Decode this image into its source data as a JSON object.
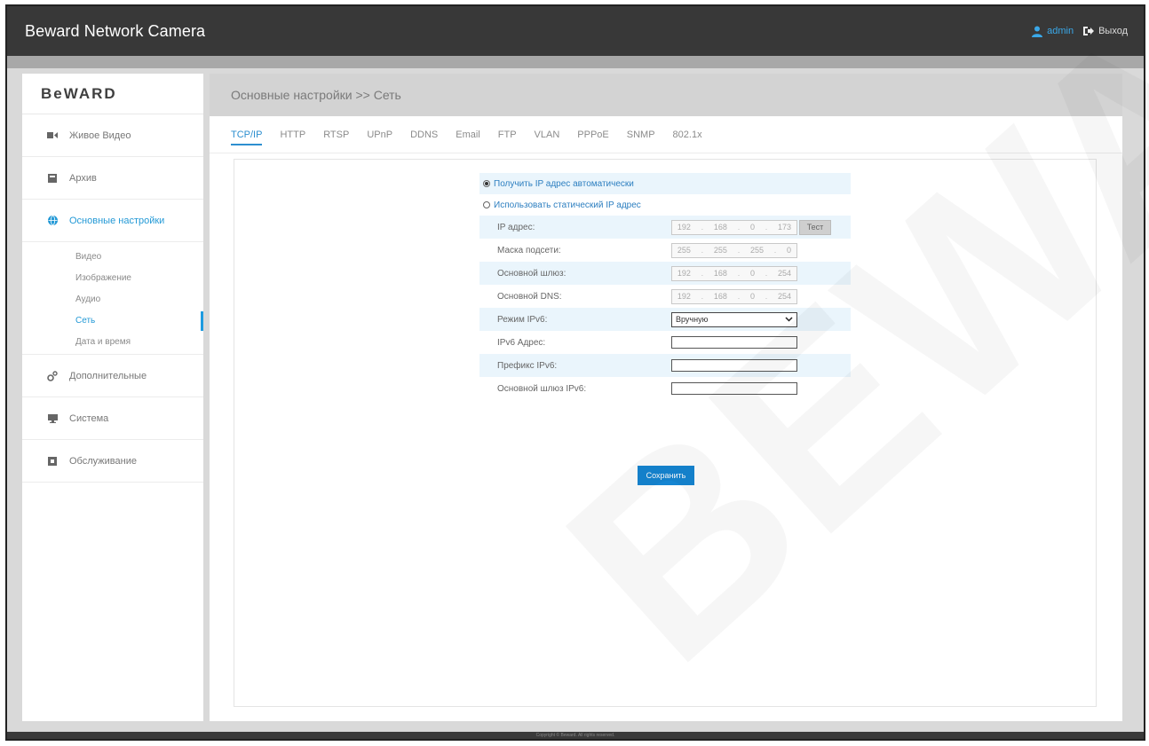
{
  "app": {
    "title": "Beward Network Camera"
  },
  "user": {
    "name": "admin",
    "logout_label": "Выход"
  },
  "logo": "BeWARD",
  "sidebar": {
    "items": [
      {
        "label": "Живое Видео",
        "icon": "video-camera-icon"
      },
      {
        "label": "Архив",
        "icon": "archive-icon"
      },
      {
        "label": "Основные настройки",
        "icon": "globe-icon",
        "active": true
      },
      {
        "label": "Дополнительные",
        "icon": "cogs-icon"
      },
      {
        "label": "Система",
        "icon": "monitor-icon"
      },
      {
        "label": "Обслуживание",
        "icon": "tools-icon"
      }
    ],
    "subitems": [
      "Видео",
      "Изображение",
      "Аудио",
      "Сеть",
      "Дата и время"
    ]
  },
  "content": {
    "header": "Основные настройки >> Сеть",
    "tabs": [
      "TCP/IP",
      "HTTP",
      "RTSP",
      "UPnP",
      "DDNS",
      "Email",
      "FTP",
      "VLAN",
      "PPPoE",
      "SNMP",
      "802.1x"
    ],
    "active_tab": "TCP/IP"
  },
  "form": {
    "radio_auto": "Получить IP адрес автоматически",
    "radio_static": "Использовать статический IP адрес",
    "ip_label": "IP адрес:",
    "ip": [
      "192",
      "168",
      "0",
      "173"
    ],
    "test_label": "Тест",
    "mask_label": "Маска подсети:",
    "mask": [
      "255",
      "255",
      "255",
      "0"
    ],
    "gateway_label": "Основной шлюз:",
    "gateway": [
      "192",
      "168",
      "0",
      "254"
    ],
    "dns_label": "Основной DNS:",
    "dns": [
      "192",
      "168",
      "0",
      "254"
    ],
    "ipv6_mode_label": "Режим IPv6:",
    "ipv6_mode_value": "Вручную",
    "ipv6_addr_label": "IPv6 Адрес:",
    "ipv6_prefix_label": "Префикс IPv6:",
    "ipv6_gateway_label": "Основной шлюз IPv6:",
    "save_label": "Сохранить"
  },
  "footer": {
    "text": "Copyright © Beward. All rights reserved."
  },
  "watermark": "BEWARD",
  "colors": {
    "accent": "#2399d6",
    "topbar": "#383838",
    "save": "#1585d2"
  }
}
